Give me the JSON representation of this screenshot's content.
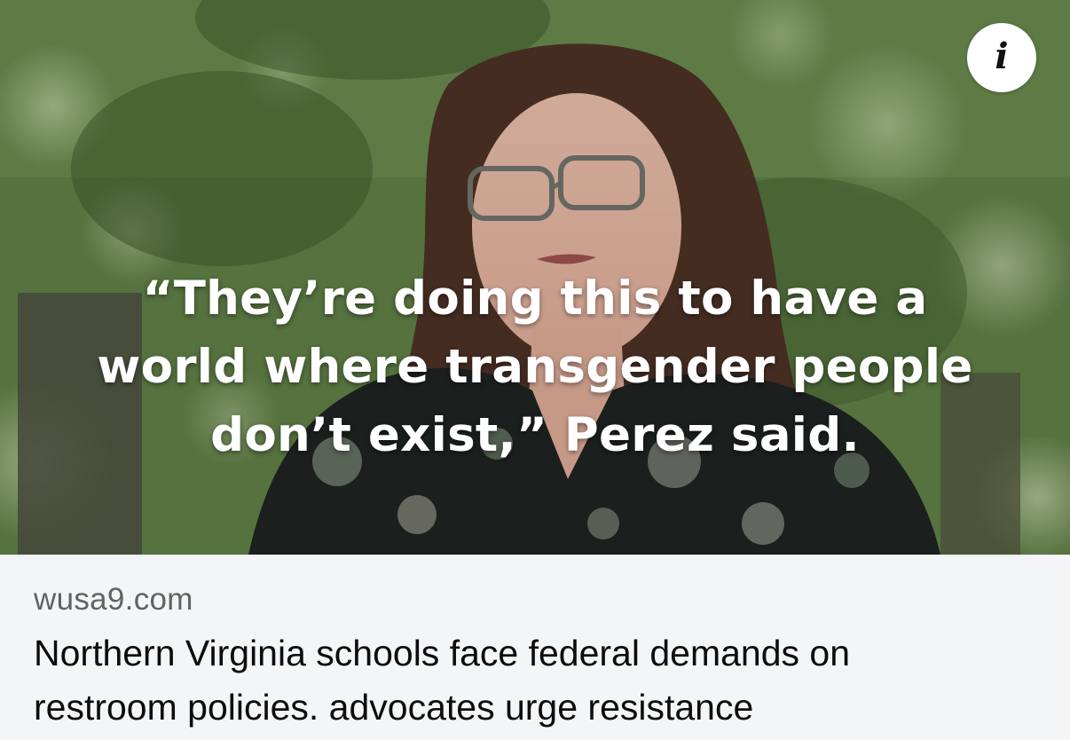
{
  "media": {
    "quote_lines": [
      "“They’re doing this to have a",
      "world where transgender people",
      "don’t exist,” Perez said."
    ],
    "info_button": {
      "icon": "info-icon",
      "glyph": "i"
    }
  },
  "link_preview": {
    "domain": "wusa9.com",
    "headline_lines": [
      "Northern Virginia schools face federal demands on",
      "restroom policies. advocates urge resistance"
    ]
  },
  "colors": {
    "footer_background": "#f4f5f6",
    "domain_text": "#5f6368",
    "headline_text": "#0d0d0d",
    "quote_text": "#ffffff",
    "foliage": "#5c7a45"
  }
}
